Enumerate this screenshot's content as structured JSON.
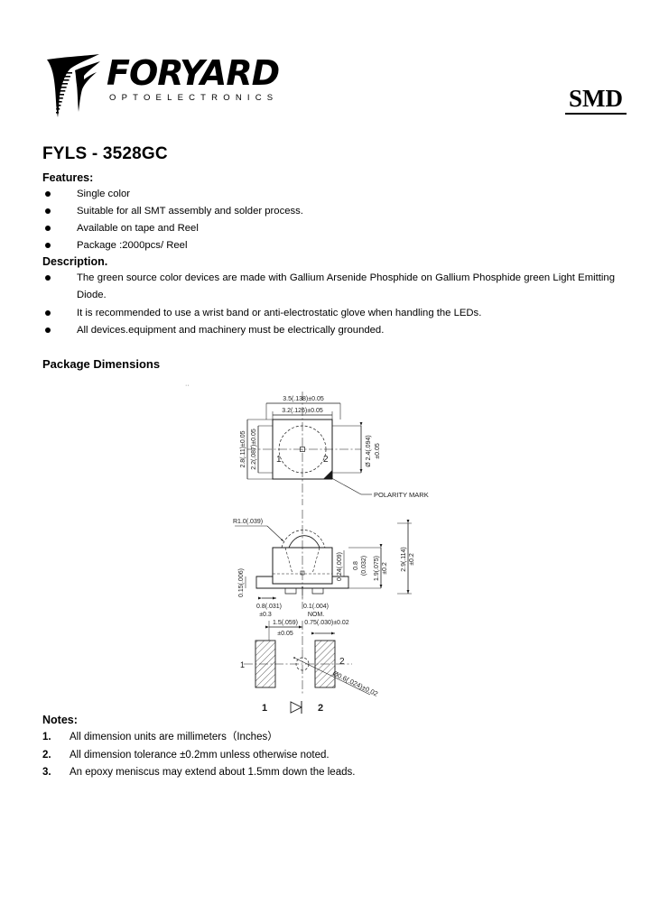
{
  "header": {
    "logo_word": "FORYARD",
    "logo_sub": "OPTOELECTRONICS",
    "logo_mark_icon": "foryard-funnel-logo-icon",
    "badge": "SMD"
  },
  "part_number": "FYLS - 3528GC",
  "features": {
    "title": "Features:",
    "items": [
      "Single color",
      "Suitable for all SMT assembly and solder process.",
      "Available on tape and Reel",
      "Package :2000pcs/ Reel"
    ]
  },
  "description": {
    "title": "Description.",
    "items": [
      "The green source color devices are made with Gallium Arsenide Phosphide on Gallium Phosphide green Light Emitting Diode.",
      "It is recommended to use a   wrist band or anti-electrostatic glove when handling the LEDs.",
      "All devices.equipment and machinery must be electrically grounded."
    ]
  },
  "package_dimensions": {
    "title": "Package Dimensions",
    "stray_mark": "··",
    "top_view": {
      "width_outer": "3.5(.138)±0.05",
      "width_body": "3.2(.126)±0.05",
      "height_outer": "2.8(.11)±0.05",
      "height_body": "2.2(.087)±0.05",
      "lens_diameter": "Ø 2.4(.094)",
      "lens_tolerance": "±0.05",
      "terminal_1": "1",
      "terminal_2": "2",
      "polarity_label": "POLARITY MARK"
    },
    "side_view": {
      "radius": "R1.0(.039)",
      "lead_thickness": "0.24(.009)",
      "step_height": "0.8",
      "step_height_inch": "(0.032)",
      "body_height": "1.9(.075)",
      "body_height_tol": "±0.2",
      "total_height": "2.9(.114)",
      "total_height_tol": "±0.2",
      "lead_width": "0.8(.031)",
      "lead_width_tol": "±0.3",
      "meniscus": "0.1(.004)",
      "meniscus_nom": "NOM.",
      "left_dim": "0.15(.006)"
    },
    "bottom_view": {
      "pad_pitch": "1.5(.059)",
      "pad_pitch_tol": "±0.05",
      "pad_width": "0.75(.030)±0.02",
      "hole_diameter": "Ø0.6(.024)±0.02",
      "terminal_1": "1",
      "terminal_2": "2",
      "symbol_terminal_1": "1",
      "symbol_terminal_2": "2",
      "diode_symbol": "diode-symbol-icon"
    }
  },
  "notes": {
    "title": "Notes:",
    "items": [
      {
        "num": "1.",
        "text": "All dimension units are millimeters（Inches）"
      },
      {
        "num": "2.",
        "text": "All dimension tolerance ±0.2mm unless otherwise noted."
      },
      {
        "num": "3.",
        "text": "An epoxy meniscus may extend about 1.5mm down the leads."
      }
    ]
  },
  "colors": {
    "ink": "#000000",
    "paper": "#ffffff",
    "drawing_line": "#1a1a1a"
  }
}
